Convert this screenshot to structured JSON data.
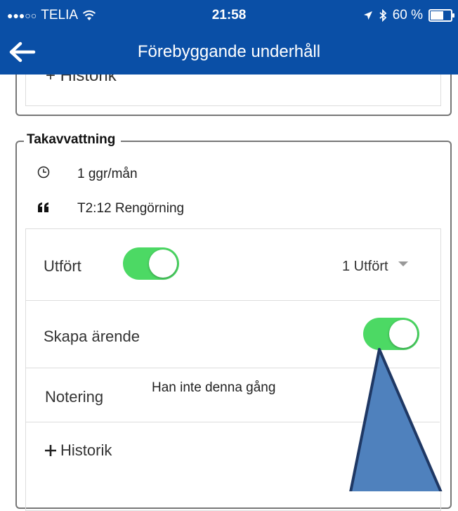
{
  "status_bar": {
    "signal_dots": "●●●○○",
    "carrier": "TELIA",
    "time": "21:58",
    "battery": "60 %",
    "battery_level": 0.6
  },
  "nav": {
    "title": "Förebyggande underhåll"
  },
  "previous_card": {
    "historik_label": "+ Historik"
  },
  "section": {
    "title": "Takavvattning",
    "frequency": "1 ggr/mån",
    "note_ref": "T2:12 Rengörning",
    "utfort_label": "Utfört",
    "utfort_toggle_on": true,
    "utfort_select_value": "1 Utfört",
    "skapa_label": "Skapa ärende",
    "skapa_toggle_on": true,
    "notering_label": "Notering",
    "notering_value": "Han inte denna gång",
    "historik_label": "Historik"
  },
  "colors": {
    "brand": "#0a4fa6",
    "toggle_on": "#4cd964",
    "annotation_fill": "#4f81bd",
    "annotation_stroke": "#1f3864"
  }
}
